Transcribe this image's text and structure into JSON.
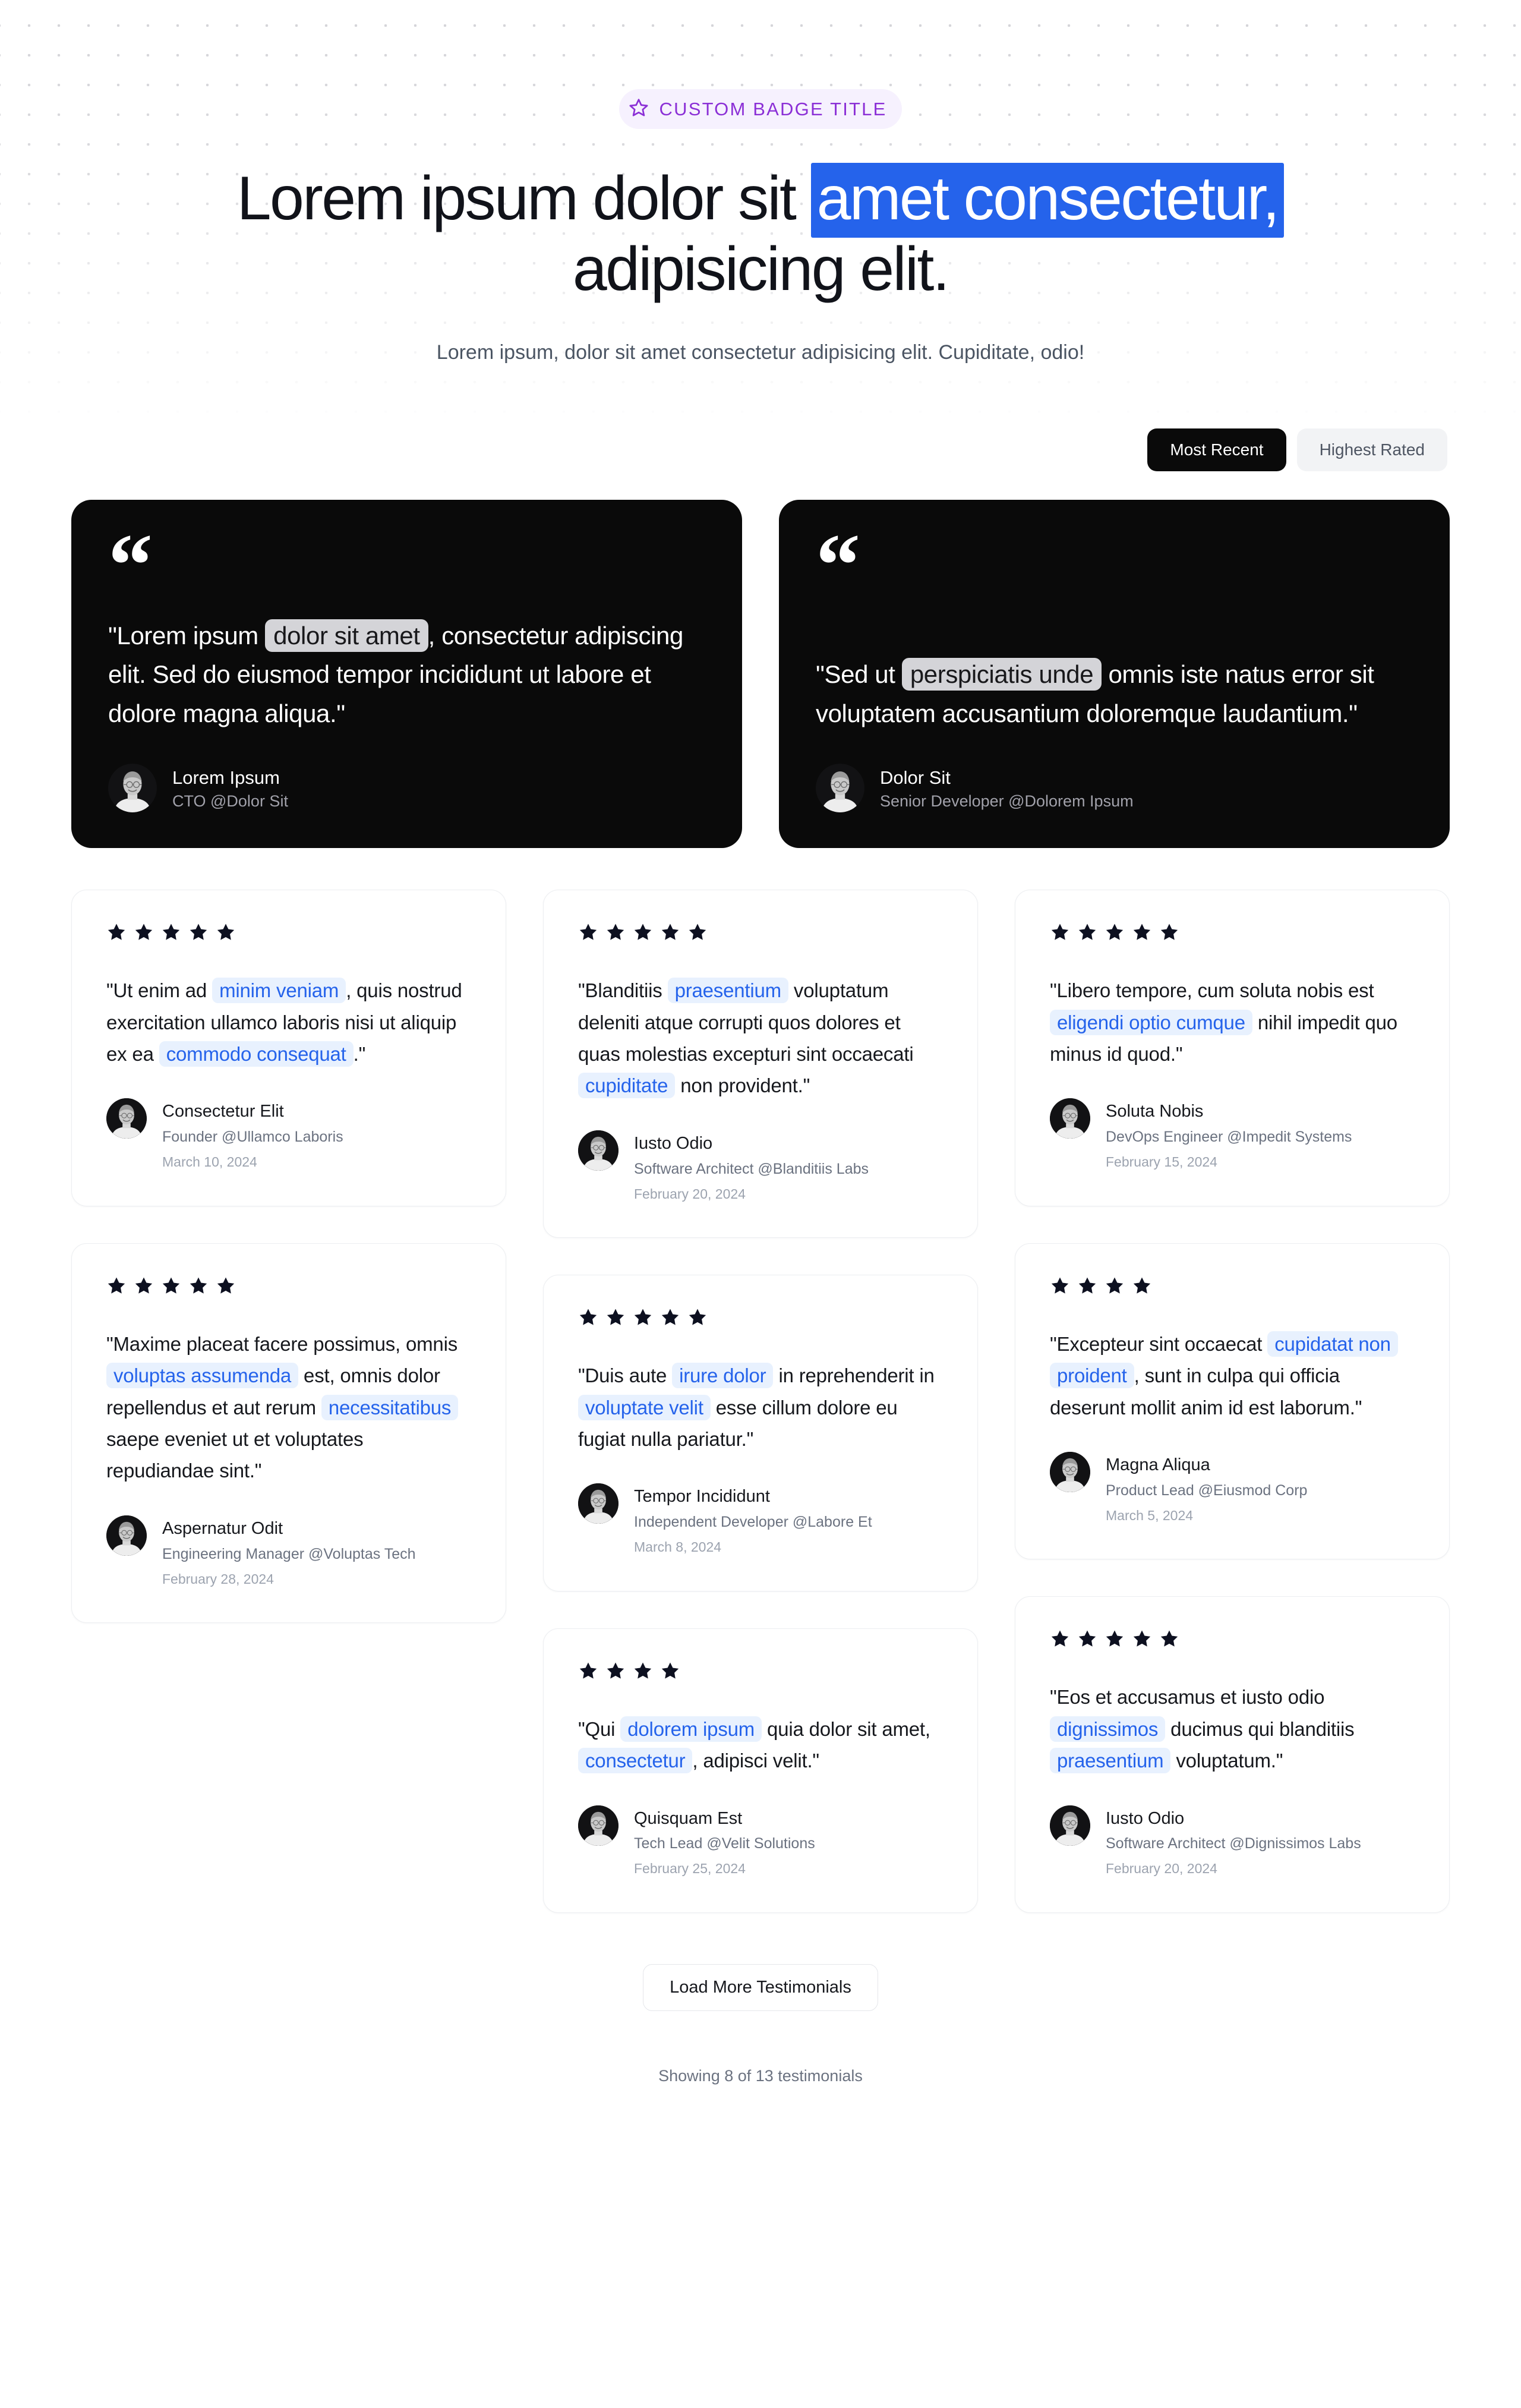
{
  "badge": {
    "label": "CUSTOM BADGE TITLE",
    "icon": "star-outline-icon",
    "color": "#8b2fd6",
    "bg": "#f6f1fe"
  },
  "heading": {
    "before": "Lorem ipsum dolor sit ",
    "highlight": "amet consectetur,",
    "after": " adipisicing elit.",
    "highlight_color": "#2563eb"
  },
  "subheading": "Lorem ipsum, dolor sit amet consectetur adipisicing elit. Cupiditate, odio!",
  "filters": [
    {
      "label": "Most Recent",
      "active": true
    },
    {
      "label": "Highest Rated",
      "active": false
    }
  ],
  "featured": [
    {
      "quote_parts": [
        {
          "text": "\"Lorem ipsum ",
          "mark": false
        },
        {
          "text": "dolor sit amet",
          "mark": true
        },
        {
          "text": ", consectetur adipiscing elit. Sed do eiusmod tempor incididunt ut labore et dolore magna aliqua.\"",
          "mark": false
        }
      ],
      "name": "Lorem Ipsum",
      "role": "CTO @Dolor Sit"
    },
    {
      "quote_parts": [
        {
          "text": "\"Sed ut ",
          "mark": false
        },
        {
          "text": "perspiciatis unde",
          "mark": true
        },
        {
          "text": " omnis iste natus error sit voluptatem accusantium doloremque laudantium.\"",
          "mark": false
        }
      ],
      "name": "Dolor Sit",
      "role": "Senior Developer @Dolorem Ipsum"
    }
  ],
  "testimonials": [
    {
      "rating": 5,
      "quote_parts": [
        {
          "text": "\"Ut enim ad ",
          "mark": false
        },
        {
          "text": "minim veniam",
          "mark": true
        },
        {
          "text": ", quis nostrud exercitation ullamco laboris nisi ut aliquip ex ea ",
          "mark": false
        },
        {
          "text": "commodo consequat",
          "mark": true
        },
        {
          "text": ".\"",
          "mark": false
        }
      ],
      "name": "Consectetur Elit",
      "role": "Founder @Ullamco Laboris",
      "date": "March 10, 2024"
    },
    {
      "rating": 5,
      "quote_parts": [
        {
          "text": "\"Maxime placeat facere possimus, omnis ",
          "mark": false
        },
        {
          "text": "voluptas assumenda",
          "mark": true
        },
        {
          "text": " est, omnis dolor repellendus et aut rerum ",
          "mark": false
        },
        {
          "text": "necessitatibus",
          "mark": true
        },
        {
          "text": " saepe eveniet ut et voluptates repudiandae sint.\"",
          "mark": false
        }
      ],
      "name": "Aspernatur Odit",
      "role": "Engineering Manager @Voluptas Tech",
      "date": "February 28, 2024"
    },
    {
      "rating": 5,
      "quote_parts": [
        {
          "text": "\"Blanditiis ",
          "mark": false
        },
        {
          "text": "praesentium",
          "mark": true
        },
        {
          "text": " voluptatum deleniti atque corrupti quos dolores et quas molestias excepturi sint occaecati ",
          "mark": false
        },
        {
          "text": "cupiditate",
          "mark": true
        },
        {
          "text": " non provident.\"",
          "mark": false
        }
      ],
      "name": "Iusto Odio",
      "role": "Software Architect @Blanditiis Labs",
      "date": "February 20, 2024"
    },
    {
      "rating": 5,
      "quote_parts": [
        {
          "text": "\"Duis aute ",
          "mark": false
        },
        {
          "text": "irure dolor",
          "mark": true
        },
        {
          "text": " in reprehenderit in ",
          "mark": false
        },
        {
          "text": "voluptate velit",
          "mark": true
        },
        {
          "text": " esse cillum dolore eu fugiat nulla pariatur.\"",
          "mark": false
        }
      ],
      "name": "Tempor Incididunt",
      "role": "Independent Developer @Labore Et",
      "date": "March 8, 2024"
    },
    {
      "rating": 4,
      "quote_parts": [
        {
          "text": "\"Qui ",
          "mark": false
        },
        {
          "text": "dolorem ipsum",
          "mark": true
        },
        {
          "text": " quia dolor sit amet, ",
          "mark": false
        },
        {
          "text": "consectetur",
          "mark": true
        },
        {
          "text": ", adipisci velit.\"",
          "mark": false
        }
      ],
      "name": "Quisquam Est",
      "role": "Tech Lead @Velit Solutions",
      "date": "February 25, 2024"
    },
    {
      "rating": 5,
      "quote_parts": [
        {
          "text": "\"Libero tempore, cum soluta nobis est ",
          "mark": false
        },
        {
          "text": "eligendi optio cumque",
          "mark": true
        },
        {
          "text": " nihil impedit quo minus id quod.\"",
          "mark": false
        }
      ],
      "name": "Soluta Nobis",
      "role": "DevOps Engineer @Impedit Systems",
      "date": "February 15, 2024"
    },
    {
      "rating": 4,
      "quote_parts": [
        {
          "text": "\"Excepteur sint occaecat ",
          "mark": false
        },
        {
          "text": "cupidatat non proident",
          "mark": true
        },
        {
          "text": ", sunt in culpa qui officia deserunt mollit anim id est laborum.\"",
          "mark": false
        }
      ],
      "name": "Magna Aliqua",
      "role": "Product Lead @Eiusmod Corp",
      "date": "March 5, 2024"
    },
    {
      "rating": 5,
      "quote_parts": [
        {
          "text": "\"Eos et accusamus et iusto odio ",
          "mark": false
        },
        {
          "text": "dignissimos",
          "mark": true
        },
        {
          "text": " ducimus qui blanditiis ",
          "mark": false
        },
        {
          "text": "praesentium",
          "mark": true
        },
        {
          "text": " voluptatum.\"",
          "mark": false
        }
      ],
      "name": "Iusto Odio",
      "role": "Software Architect @Dignissimos Labs",
      "date": "February 20, 2024"
    }
  ],
  "footer": {
    "load_more_label": "Load More Testimonials",
    "showing_text": "Showing 8 of 13 testimonials"
  }
}
